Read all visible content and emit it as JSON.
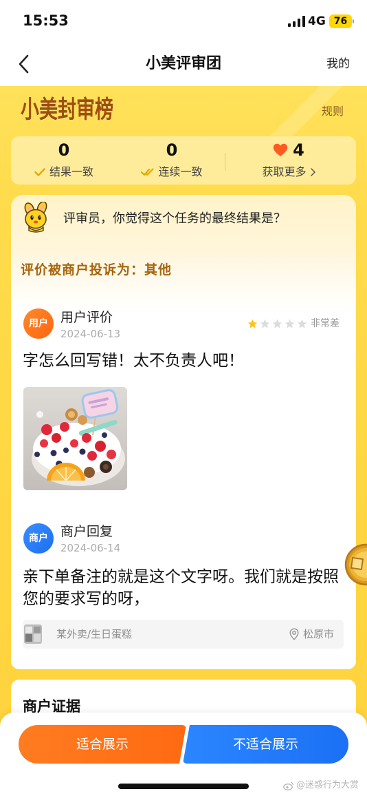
{
  "status_bar": {
    "time": "15:53",
    "network": "4G",
    "battery": "76"
  },
  "nav": {
    "title": "小美评审团",
    "right_link": "我的",
    "back_icon": "chevron-left-icon"
  },
  "board": {
    "title": "小美封审榜",
    "rules_link": "规则"
  },
  "stats": [
    {
      "value": "0",
      "label": "结果一致",
      "icon": "check-icon"
    },
    {
      "value": "0",
      "label": "连续一致",
      "icon": "double-check-icon"
    },
    {
      "value": "4",
      "label": "获取更多",
      "icon": "heart-icon",
      "trailing_icon": "chevron-right-icon"
    }
  ],
  "prompt": {
    "mascot_icon": "mascot-icon",
    "text": "评审员，你觉得这个任务的最终结果是？"
  },
  "complaint": {
    "reason": "评价被商户投诉为：其他",
    "user_review": {
      "avatar_label": "用户",
      "title": "用户评价",
      "date": "2024-06-13",
      "rating": 1,
      "rating_max": 5,
      "rating_label": "非常差",
      "text": "字怎么回写错！太不负责人吧！"
    },
    "merchant_reply": {
      "avatar_label": "商户",
      "title": "商户回复",
      "date": "2024-06-14",
      "text": "亲下单备注的就是这个文字呀。我们就是按照您的要求写的呀，"
    },
    "order": {
      "store": "某外卖/生日蛋糕",
      "location_icon": "location-pin-icon",
      "city": "松原市"
    }
  },
  "evidence": {
    "title": "商户证据"
  },
  "actions": {
    "approve": "适合展示",
    "reject": "不适合展示"
  },
  "floating_widget": {
    "icon": "gold-coin-icon"
  },
  "watermark": "@迷惑行为大赏",
  "colors": {
    "brand_yellow": "#FFD743",
    "approve_orange": "#FF6E14",
    "reject_blue": "#1F7BFF",
    "reason_brown": "#A8650F",
    "star_filled": "#FFC21A",
    "star_empty": "#DCDCDC",
    "heart": "#FF5A22",
    "check": "#E0A800"
  }
}
